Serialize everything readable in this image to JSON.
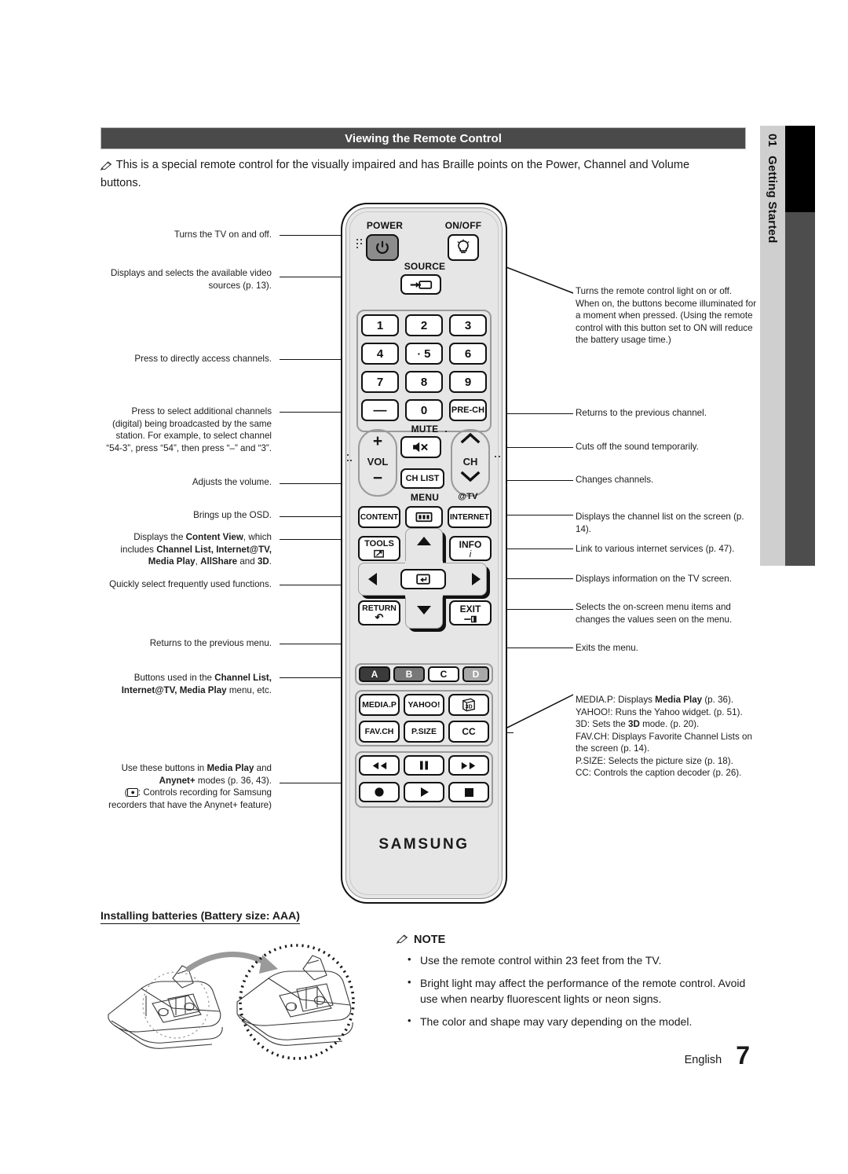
{
  "header": {
    "title": "Viewing the Remote Control"
  },
  "side_tab": {
    "number": "01",
    "label": "Getting Started"
  },
  "intro": {
    "icon": "pencil-note-icon",
    "text": "This is a special remote control for the visually impaired and has Braille points on the Power, Channel and Volume buttons."
  },
  "annotations_left": [
    {
      "id": "power",
      "text": "Turns the TV on and off."
    },
    {
      "id": "source",
      "text": "Displays and selects the available video sources (p. 13)."
    },
    {
      "id": "numbers",
      "text": "Press to directly access channels."
    },
    {
      "id": "dash",
      "text": "Press to select additional channels (digital) being broadcasted by the same station. For example, to select channel “54-3”, press “54”, then press “–” and “3”."
    },
    {
      "id": "vol",
      "text": "Adjusts the volume."
    },
    {
      "id": "menu",
      "text": "Brings up the OSD."
    },
    {
      "id": "content",
      "text": "Displays the Content View, which includes Channel List, Internet@TV, Media Play, AllShare and 3D.",
      "bold": [
        "Content View",
        "Channel List, Internet@TV,",
        "Media Play",
        "AllShare",
        "3D"
      ]
    },
    {
      "id": "tools",
      "text": "Quickly select frequently used functions."
    },
    {
      "id": "return",
      "text": "Returns to the previous menu."
    },
    {
      "id": "abcd",
      "text": "Buttons used in the Channel List, Internet@TV, Media Play menu, etc.",
      "bold": [
        "Channel List,",
        "Internet@TV, Media Play"
      ]
    },
    {
      "id": "media",
      "text": "Use these buttons in Media Play and Anynet+ modes (p. 36, 43). (■: Controls recording for Samsung recorders that have the Anynet+ feature)",
      "bold": [
        "Media Play",
        "Anynet+"
      ]
    }
  ],
  "annotations_right": [
    {
      "id": "onoff",
      "text": "Turns the remote control light on or off. When on, the buttons become illuminated for a moment when pressed. (Using the remote control with this button set to ON will reduce the battery usage time.)"
    },
    {
      "id": "prech",
      "text": "Returns to the previous channel."
    },
    {
      "id": "mute",
      "text": "Cuts off the sound temporarily."
    },
    {
      "id": "ch",
      "text": "Changes channels."
    },
    {
      "id": "chlist",
      "text": "Displays the channel list on the screen (p. 14)."
    },
    {
      "id": "internet",
      "text": "Link to various internet services (p. 47)."
    },
    {
      "id": "info",
      "text": "Displays information on the TV screen."
    },
    {
      "id": "dpad",
      "text": "Selects the on-screen menu items and changes the values seen on the menu."
    },
    {
      "id": "exit",
      "text": "Exits the menu."
    },
    {
      "id": "fnbuttons",
      "text": "MEDIA.P: Displays Media Play (p. 36). YAHOO!: Runs the Yahoo widget. (p. 51). 3D: Sets the 3D mode. (p. 20). FAV.CH: Displays Favorite Channel Lists on the screen (p. 14). P.SIZE: Selects the picture size (p. 18). CC: Controls the caption decoder (p. 26).",
      "bold": [
        "Media Play",
        "3D"
      ]
    }
  ],
  "remote": {
    "brand": "SAMSUNG",
    "labels": {
      "power": "POWER",
      "onoff": "ON/OFF",
      "source": "SOURCE",
      "mute": "MUTE",
      "vol": "VOL",
      "ch": "CH",
      "ch_list": "CH LIST",
      "pre_ch": "PRE-CH",
      "menu": "MENU",
      "at_tv": "@TV",
      "content": "CONTENT",
      "internet": "INTERNET",
      "tools": "TOOLS",
      "info": "INFO",
      "return": "RETURN",
      "exit": "EXIT"
    },
    "keypad": [
      "1",
      "2",
      "3",
      "4",
      "5",
      "6",
      "7",
      "8",
      "9",
      "—",
      "0",
      "PRE-CH"
    ],
    "keypad_dot_key": "5",
    "color_buttons": [
      {
        "label": "A",
        "color": "#3a3a3a"
      },
      {
        "label": "B",
        "color": "#787878"
      },
      {
        "label": "C",
        "color": "#ffffff"
      },
      {
        "label": "D",
        "color": "#a8a8a8"
      }
    ],
    "function_buttons": [
      "MEDIA.P",
      "YAHOO!",
      "3D",
      "FAV.CH",
      "P.SIZE",
      "CC"
    ],
    "media_buttons": [
      "rewind-icon",
      "pause-icon",
      "fast-forward-icon",
      "record-icon",
      "play-icon",
      "stop-icon"
    ],
    "icons": {
      "power": "power-icon",
      "onoff": "lightbulb-icon",
      "source": "source-input-icon",
      "mute": "mute-speaker-icon",
      "vol_up": "plus-icon",
      "vol_down": "minus-icon",
      "ch_up": "chevron-up-icon",
      "ch_down": "chevron-down-icon",
      "menu": "menu-bars-icon",
      "tools": "tools-arrow-icon",
      "info": "info-i-icon",
      "return": "return-arrow-icon",
      "exit": "exit-icon",
      "enter": "enter-icon",
      "3d": "3d-cube-icon"
    }
  },
  "battery": {
    "title": "Installing batteries (Battery size: AAA)",
    "art": "remote-battery-compartment-diagram"
  },
  "note": {
    "icon": "pencil-note-icon",
    "heading": "NOTE",
    "items": [
      "Use the remote control within 23 feet from the TV.",
      "Bright light may affect the performance of the remote control. Avoid use when nearby fluorescent lights or neon signs.",
      "The color and shape may vary depending on the model."
    ]
  },
  "footer": {
    "language": "English",
    "page": "7"
  },
  "colors": {
    "header_bg": "#4a4a4a",
    "side_tab_bg": "#cfcfcf",
    "side_block_black": "#000000",
    "side_block_gray": "#4d4d4d",
    "remote_body": "#e6e6e6",
    "power_key": "#8c8c8c"
  }
}
